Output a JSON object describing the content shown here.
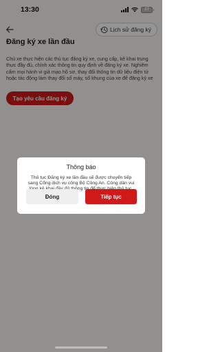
{
  "status_bar": {
    "time": "13:30",
    "battery": "27"
  },
  "header": {
    "history_label": "Lịch sử đăng ký"
  },
  "main": {
    "title": "Đăng ký xe lần đầu",
    "description": "Chủ xe thực hiện các thủ tục đăng ký xe, cung cấp, kê khai trung thực đầy đủ, chính xác thông tin quy định về đăng ký xe. Nghiêm cấm mọi hành vi giả mạo hồ sơ, thay đổi thông tin dữ liệu điện tử hoặc tác động làm thay đổi số máy, số khung của xe để đăng ký xe",
    "create_button": "Tạo yêu cầu đăng ký"
  },
  "dialog": {
    "title": "Thông báo",
    "message": "Thủ tục Đăng ký xe lần đầu sẽ được chuyển tiếp sang Cổng dịch vụ công Bộ Công An. Công dân vui lòng kê khai đầy đủ thông tin để thực hiện thủ tục.",
    "close_button": "Đóng",
    "continue_button": "Tiếp tục"
  },
  "colors": {
    "accent": "#d01a1a",
    "background": "#fbf8f6",
    "overlay": "rgba(0,0,0,0.42)"
  },
  "icons": [
    "back-arrow-icon",
    "history-clock-icon",
    "signal-icon",
    "wifi-icon",
    "battery-icon"
  ]
}
